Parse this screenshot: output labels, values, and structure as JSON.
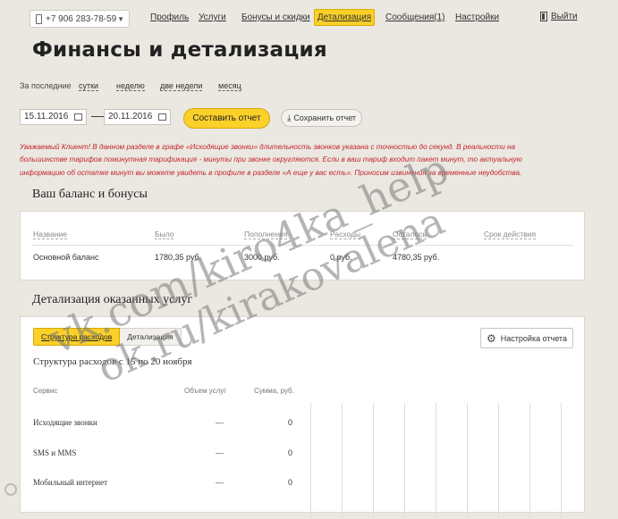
{
  "header": {
    "phone": "+7 906 283-78-59",
    "nav": [
      "Профиль",
      "Услуги",
      "Бонусы и скидки",
      "Детализация",
      "Сообщения(1)",
      "Настройки"
    ],
    "active_nav": "Детализация",
    "logout": "Выйти"
  },
  "page_title": "Финансы и детализация",
  "period": {
    "label": "За последние",
    "options": [
      "сутки",
      "неделю",
      "две недели",
      "месяц"
    ]
  },
  "dates": {
    "from": "15.11.2016",
    "separator": "—",
    "to": "20.11.2016"
  },
  "buttons": {
    "compose_report": "Составить отчет",
    "save_report": "Сохранить отчет",
    "report_settings": "Настройка отчета"
  },
  "notice": "Уважаемый Клиент! В данном разделе в графе «Исходящие звонки» длительность звонков указана с точностью до секунд. В реальности на большинстве тарифов поминутная тарификация - минуты при звонке округляются. Если в ваш тариф входит пакет минут, то актуальную информацию об остатке минут вы можете увидеть в профиле в разделе «А еще у вас есть». Приносим извинения за временные неудобства.",
  "balance": {
    "title": "Ваш баланс и бонусы",
    "columns": [
      "Название",
      "Было",
      "Пополнения",
      "Расходы",
      "Осталось",
      "Срок действия"
    ],
    "rows": [
      {
        "name": "Основной баланс",
        "was": "1780,35 руб.",
        "topup": "3000 руб.",
        "spent": "0 руб.",
        "left": "4780,35 руб.",
        "term": ""
      }
    ]
  },
  "details": {
    "title": "Детализация оказанных услуг",
    "tabs": [
      "Структура расходов",
      "Детализация"
    ],
    "active_tab": "Структура расходов",
    "structure_title": "Структура расходов с 15 по 20 ноября",
    "columns": [
      "Сервис",
      "Объем услуг",
      "Сумма, руб."
    ],
    "rows": [
      {
        "service": "Исходящие звонки",
        "volume": "—",
        "sum": "0"
      },
      {
        "service": "SMS и MMS",
        "volume": "—",
        "sum": "0"
      },
      {
        "service": "Мобильный интернет",
        "volume": "—",
        "sum": "0"
      }
    ]
  },
  "watermark": {
    "line1": "vk.com/kiro4ka_help",
    "line2": "ok.ru/kirakovalena"
  }
}
